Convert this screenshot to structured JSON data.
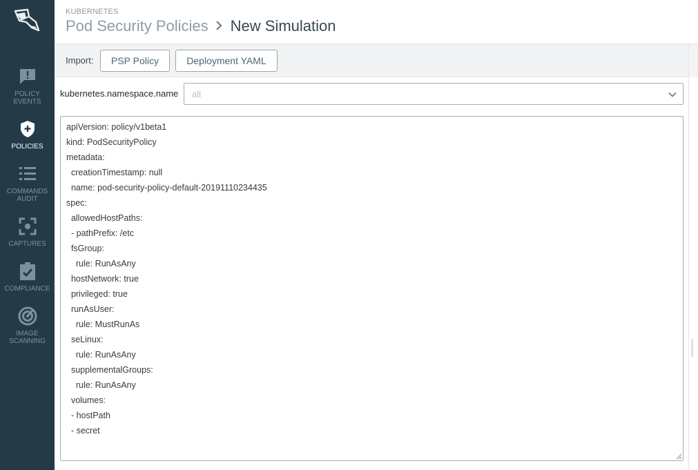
{
  "header": {
    "section": "KUBERNETES",
    "parent": "Pod Security Policies",
    "separator": ">",
    "title": "New Simulation"
  },
  "sidebar": {
    "items": [
      {
        "label": "POLICY EVENTS",
        "icon": "alert-bubble-icon",
        "active": false
      },
      {
        "label": "POLICIES",
        "icon": "shield-plus-icon",
        "active": true
      },
      {
        "label": "COMMANDS AUDIT",
        "icon": "list-icon",
        "active": false
      },
      {
        "label": "CAPTURES",
        "icon": "capture-icon",
        "active": false
      },
      {
        "label": "COMPLIANCE",
        "icon": "clipboard-check-icon",
        "active": false
      },
      {
        "label": "IMAGE SCANNING",
        "icon": "radar-icon",
        "active": false
      }
    ]
  },
  "import": {
    "label": "Import:",
    "psp_button": "PSP Policy",
    "yaml_button": "Deployment YAML"
  },
  "namespace": {
    "label": "kubernetes.namespace.name",
    "value": "all"
  },
  "editor": {
    "content": "apiVersion: policy/v1beta1\nkind: PodSecurityPolicy\nmetadata:\n  creationTimestamp: null\n  name: pod-security-policy-default-20191110234435\nspec:\n  allowedHostPaths:\n  - pathPrefix: /etc\n  fsGroup:\n    rule: RunAsAny\n  hostNetwork: true\n  privileged: true\n  runAsUser:\n    rule: MustRunAs\n  seLinux:\n    rule: RunAsAny\n  supplementalGroups:\n    rule: RunAsAny\n  volumes:\n  - hostPath\n  - secret"
  },
  "colors": {
    "sidebar_bg": "#243b47",
    "sidebar_inactive": "#7c919c",
    "sidebar_active": "#ffffff",
    "button_text": "#4d6573"
  }
}
